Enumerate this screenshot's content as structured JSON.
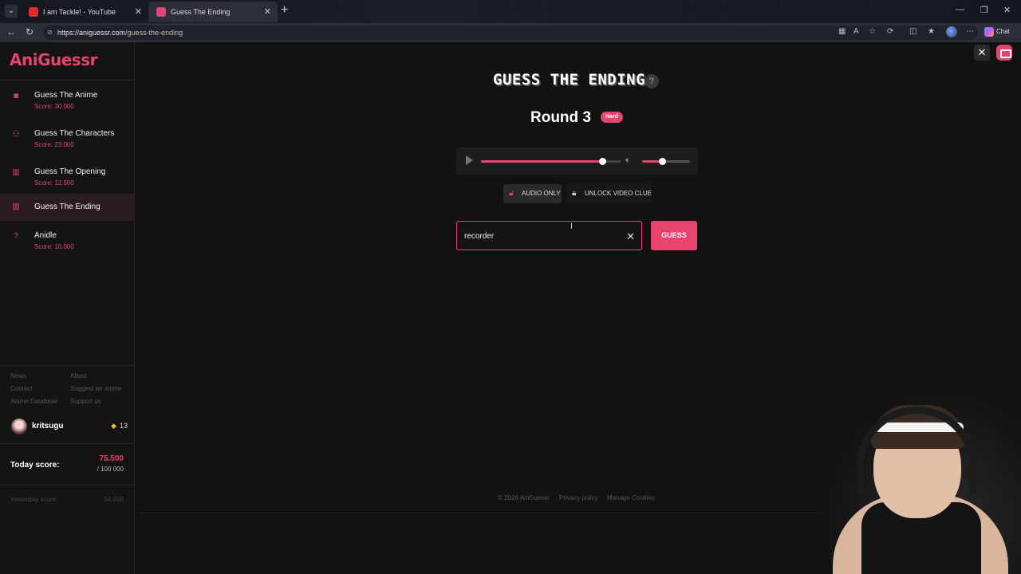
{
  "browser": {
    "tabs": [
      {
        "title": "I am Tackle! - YouTube"
      },
      {
        "title": "Guess The Ending"
      }
    ],
    "url_host": "https://aniguessr.com",
    "url_path": "/guess-the-ending",
    "chat_label": "Chat"
  },
  "sidebar": {
    "logo": "AniGuessr",
    "items": [
      {
        "label": "Guess The Anime",
        "score": "Score: 30.000",
        "icon": "camera-icon"
      },
      {
        "label": "Guess The Characters",
        "score": "Score: 23.000",
        "icon": "users-icon"
      },
      {
        "label": "Guess The Opening",
        "score": "Score: 12.500",
        "icon": "music-bars-icon"
      },
      {
        "label": "Guess The Ending",
        "score": "",
        "icon": "music-bars-icon"
      },
      {
        "label": "Anidle",
        "score": "Score: 10.000",
        "icon": "question-icon"
      }
    ],
    "links": {
      "news": "News",
      "about": "About",
      "contact": "Contact",
      "suggest": "Suggest an anime",
      "database": "Anime Database",
      "support": "Support us"
    },
    "user": {
      "name": "kritsugu",
      "tickets": "13"
    },
    "today": {
      "label": "Today score:",
      "score": "75.500",
      "max": "/ 100 000"
    },
    "yesterday": {
      "label": "Yesterday score:",
      "score": "54.000"
    }
  },
  "game": {
    "title": "GUESS THE ENDING",
    "help": "?",
    "round": "Round 3",
    "difficulty": "Hard",
    "player": {
      "progress": 0.87,
      "volume": 0.42
    },
    "modes": {
      "audio": "AUDIO ONLY",
      "video": "UNLOCK VIDEO CLUE"
    },
    "input_value": "recorder",
    "guess_label": "GUESS"
  },
  "footer": {
    "copyright": "© 2026 AniGuessr",
    "privacy": "Privacy policy",
    "cookies": "Manage Cookies"
  },
  "colors": {
    "accent": "#e8436d",
    "background": "#121212",
    "sidebar": "#141414"
  }
}
